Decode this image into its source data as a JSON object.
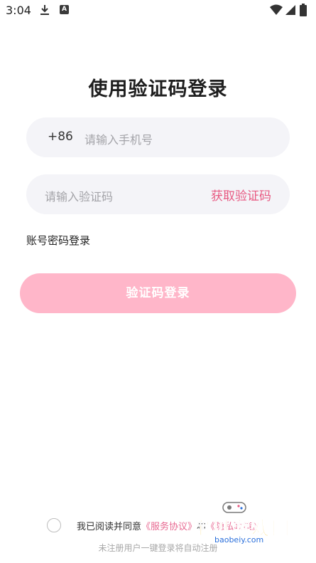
{
  "status_bar": {
    "time": "3:04",
    "app_icon_letter": "A",
    "icons": [
      "download-icon",
      "app-notification-icon",
      "wifi-icon",
      "signal-icon",
      "battery-icon"
    ]
  },
  "title": "使用验证码登录",
  "phone": {
    "country_code": "+86",
    "placeholder": "请输入手机号"
  },
  "code": {
    "placeholder": "请输入验证码",
    "get_code_label": "获取验证码"
  },
  "password_login_label": "账号密码登录",
  "login_button_label": "验证码登录",
  "agreement": {
    "prefix": "我已阅读并同意",
    "service_link": "《服务协议》",
    "connector": "和",
    "privacy_link": "《隐私政策》",
    "note": "未注册用户一键登录将自动注册"
  },
  "watermark": {
    "title": "宝贝游戏网",
    "url": "baobeiy.com"
  },
  "colors": {
    "accent": "#e85a82",
    "button_bg": "#ffb6c9",
    "field_bg": "#f4f4f8",
    "placeholder": "#a3a3a8"
  }
}
